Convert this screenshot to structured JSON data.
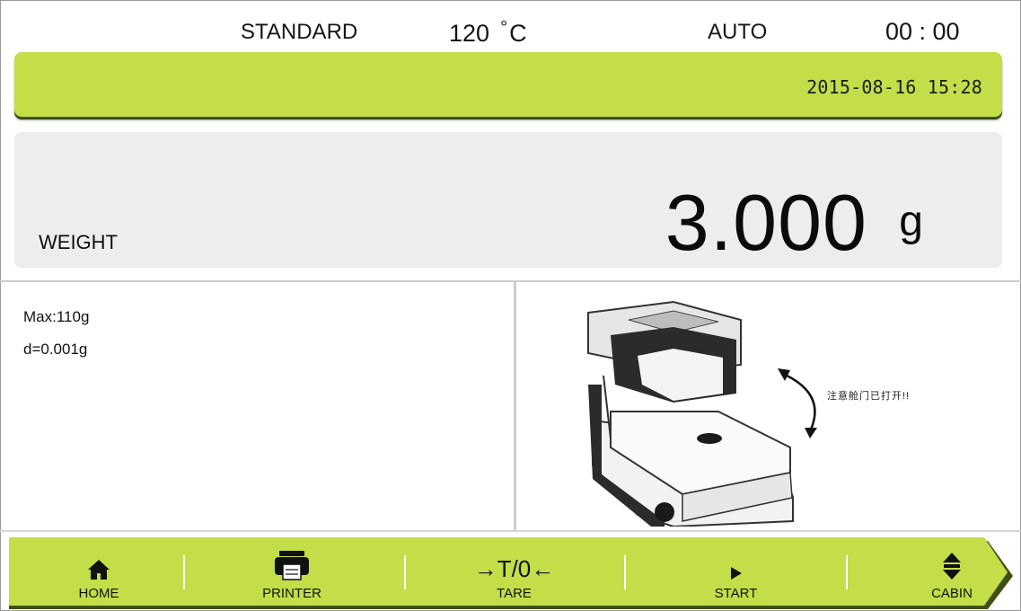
{
  "status": {
    "mode": "STANDARD",
    "temperature_value": "120",
    "temperature_unit": "C",
    "run_mode": "AUTO",
    "timer": "00 : 00"
  },
  "datetime": "2015-08-16  15:28",
  "weight": {
    "label": "WEIGHT",
    "value": "3.000",
    "unit": "g"
  },
  "specs": {
    "max": "Max:110g",
    "d": "d=0.001g"
  },
  "notice": "注意舱门已打开!!",
  "nav": {
    "home": "HOME",
    "printer": "PRINTER",
    "tare": "TARE",
    "tare_symbol": "→T/0←",
    "start": "START",
    "cabin": "CABIN"
  },
  "colors": {
    "accent_green": "#c3de48",
    "panel_gray": "#ededed"
  },
  "icons": {
    "home": "home-icon",
    "printer": "printer-icon",
    "start": "play-icon",
    "cabin": "up-down-arrows-icon"
  }
}
